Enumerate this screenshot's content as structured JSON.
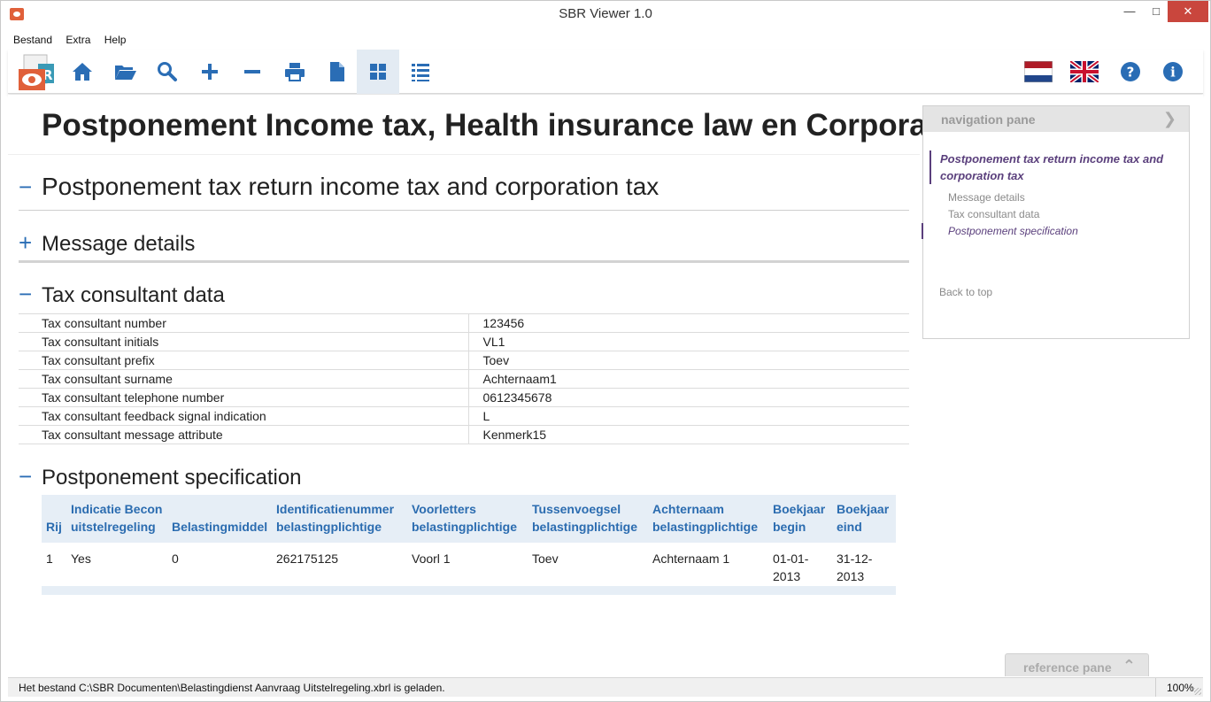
{
  "window": {
    "title": "SBR Viewer 1.0"
  },
  "menu": {
    "items": [
      "Bestand",
      "Extra",
      "Help"
    ]
  },
  "toolbar": {
    "buttons": [
      "home-icon",
      "folder-open-icon",
      "search-icon",
      "plus-icon",
      "minus-icon",
      "print-icon",
      "document-icon",
      "grid-view-icon",
      "list-view-icon"
    ],
    "right_buttons": [
      "flag-nl-icon",
      "flag-uk-icon",
      "help-icon",
      "info-icon"
    ],
    "active": "grid-view-icon",
    "accent": "#2a6db5"
  },
  "document": {
    "title": "Postponement Income tax, Health insurance law en Corporation tax",
    "section_main": {
      "toggle": "−",
      "title": "Postponement tax return income tax and corporation tax"
    },
    "section_message": {
      "toggle": "+",
      "title": "Message details"
    },
    "section_consultant": {
      "toggle": "−",
      "title": "Tax consultant data",
      "rows": [
        {
          "label": "Tax consultant number",
          "value": "123456"
        },
        {
          "label": "Tax consultant initials",
          "value": "VL1"
        },
        {
          "label": "Tax consultant prefix",
          "value": "Toev"
        },
        {
          "label": "Tax consultant surname",
          "value": "Achternaam1"
        },
        {
          "label": "Tax consultant telephone number",
          "value": "0612345678"
        },
        {
          "label": "Tax consultant feedback signal indication",
          "value": "L"
        },
        {
          "label": "Tax consultant message attribute",
          "value": "Kenmerk15"
        }
      ]
    },
    "section_spec": {
      "toggle": "−",
      "title": "Postponement specification",
      "headers": [
        "Rij",
        "Indicatie Becon uitstelregeling",
        "Belastingmiddel",
        "Identificatienummer belastingplichtige",
        "Voorletters belastingplichtige",
        "Tussenvoegsel belastingplichtige",
        "Achternaam belastingplichtige",
        "Boekjaar begin",
        "Boekjaar eind"
      ],
      "rows": [
        [
          "1",
          "Yes",
          "0",
          "262175125",
          "Voorl 1",
          "Toev",
          "Achternaam 1",
          "01-01-2013",
          "31-12-2013"
        ]
      ]
    }
  },
  "navigation_pane": {
    "title": "navigation pane",
    "main": "Postponement tax return income tax and corporation tax",
    "items": [
      "Message details",
      "Tax consultant data",
      "Postponement specification"
    ],
    "back": "Back to top"
  },
  "reference_pane": {
    "title": "reference pane"
  },
  "status": {
    "text": "Het bestand C:\\SBR Documenten\\Belastingdienst Aanvraag Uitstelregeling.xbrl is geladen.",
    "zoom": "100%"
  }
}
